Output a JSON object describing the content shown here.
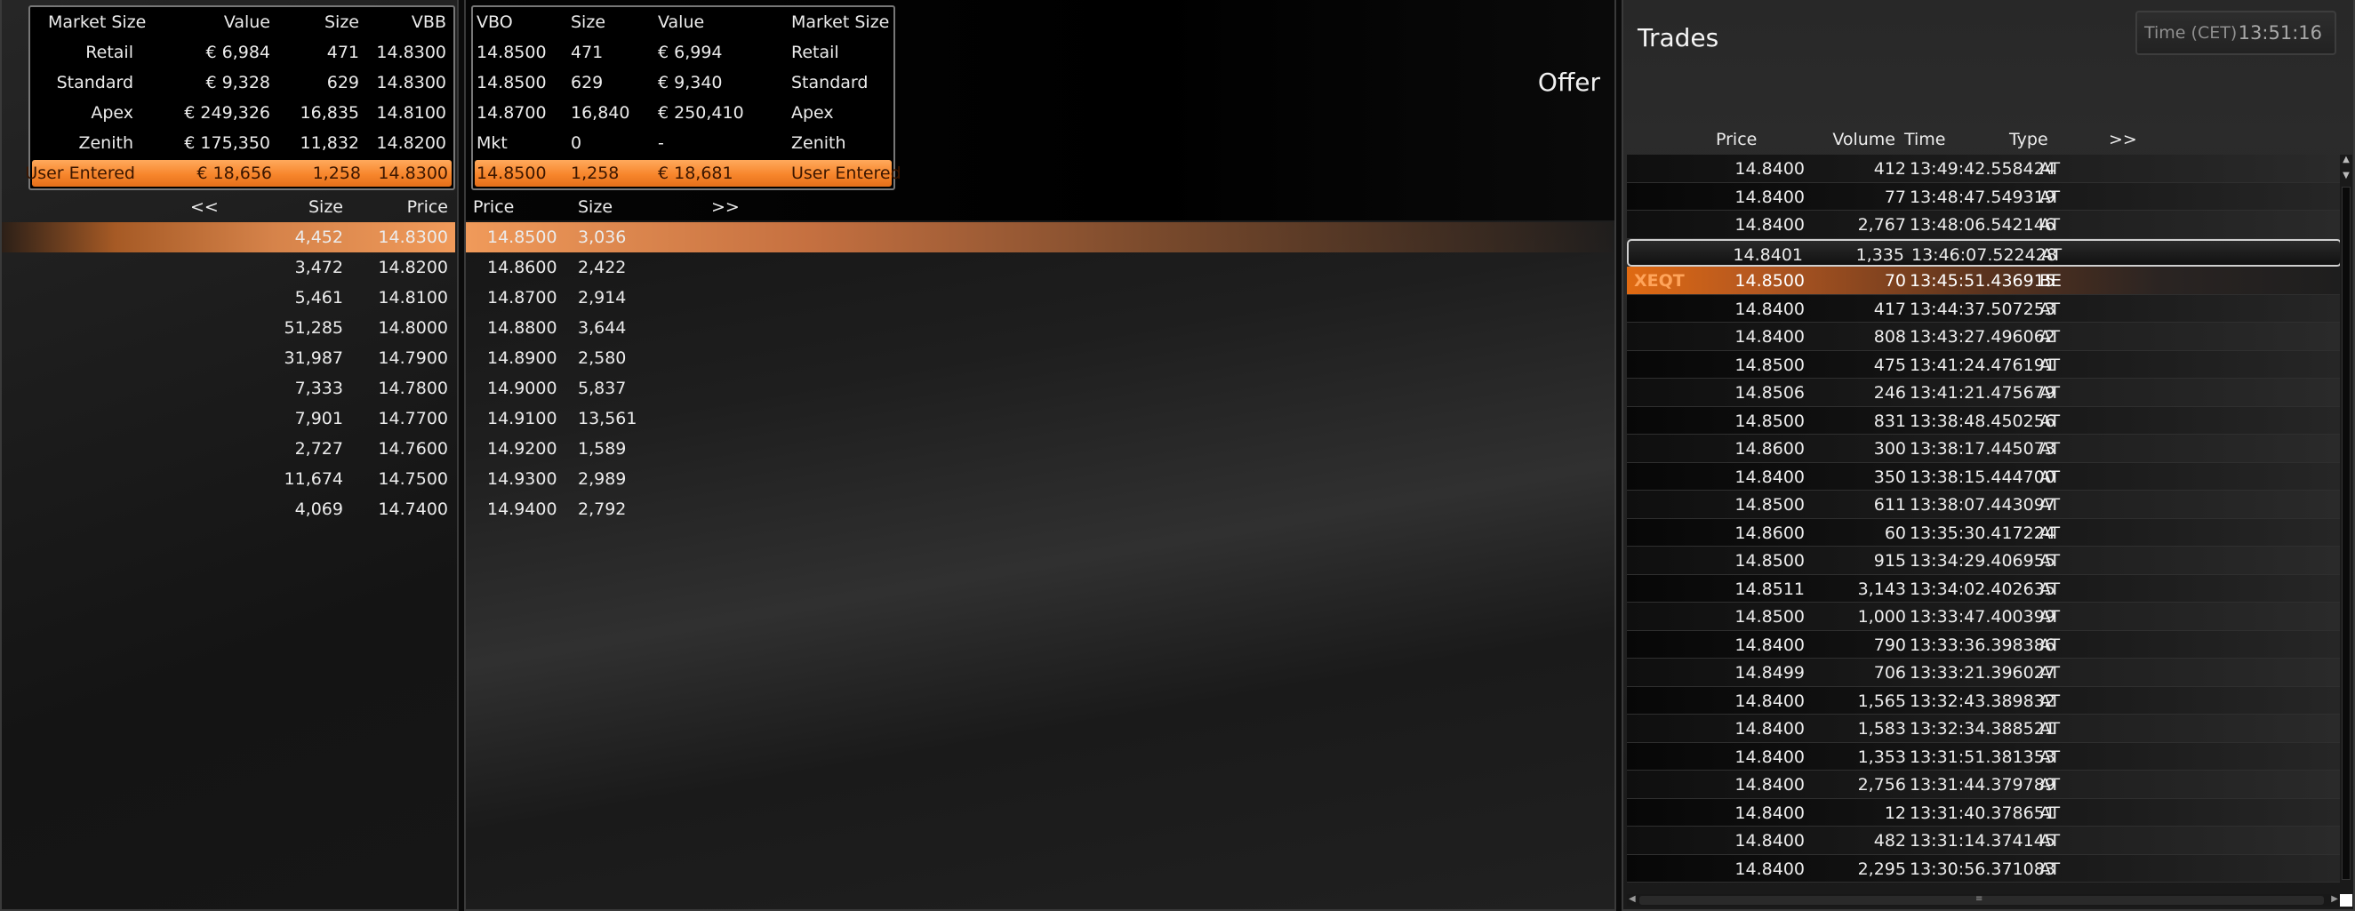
{
  "bid_summary": {
    "headers": [
      "Market Size",
      "Value",
      "Size",
      "VBB"
    ],
    "rows": [
      {
        "market": "Retail",
        "value": "€ 6,984",
        "size": "471",
        "vb": "14.8300"
      },
      {
        "market": "Standard",
        "value": "€ 9,328",
        "size": "629",
        "vb": "14.8300"
      },
      {
        "market": "Apex",
        "value": "€ 249,326",
        "size": "16,835",
        "vb": "14.8100"
      },
      {
        "market": "Zenith",
        "value": "€ 175,350",
        "size": "11,832",
        "vb": "14.8200"
      }
    ],
    "user": {
      "market": "User Entered",
      "value": "€ 18,656",
      "size": "1,258",
      "vb": "14.8300"
    }
  },
  "offer_summary": {
    "headers": [
      "VBO",
      "Size",
      "Value",
      "Market Size"
    ],
    "rows": [
      {
        "vb": "14.8500",
        "size": "471",
        "value": "€ 6,994",
        "market": "Retail"
      },
      {
        "vb": "14.8500",
        "size": "629",
        "value": "€ 9,340",
        "market": "Standard"
      },
      {
        "vb": "14.8700",
        "size": "16,840",
        "value": "€ 250,410",
        "market": "Apex"
      },
      {
        "vb": "Mkt",
        "size": "0",
        "value": "-",
        "market": "Zenith"
      }
    ],
    "user": {
      "vb": "14.8500",
      "size": "1,258",
      "value": "€ 18,681",
      "market": "User Entered"
    }
  },
  "bid_ladder": {
    "nav": "<<",
    "size_header": "Size",
    "price_header": "Price",
    "rows": [
      {
        "size": "4,452",
        "price": "14.8300"
      },
      {
        "size": "3,472",
        "price": "14.8200"
      },
      {
        "size": "5,461",
        "price": "14.8100"
      },
      {
        "size": "51,285",
        "price": "14.8000"
      },
      {
        "size": "31,987",
        "price": "14.7900"
      },
      {
        "size": "7,333",
        "price": "14.7800"
      },
      {
        "size": "7,901",
        "price": "14.7700"
      },
      {
        "size": "2,727",
        "price": "14.7600"
      },
      {
        "size": "11,674",
        "price": "14.7500"
      },
      {
        "size": "4,069",
        "price": "14.7400"
      }
    ]
  },
  "offer_ladder": {
    "title": "Offer",
    "nav": ">>",
    "price_header": "Price",
    "size_header": "Size",
    "rows": [
      {
        "price": "14.8500",
        "size": "3,036"
      },
      {
        "price": "14.8600",
        "size": "2,422"
      },
      {
        "price": "14.8700",
        "size": "2,914"
      },
      {
        "price": "14.8800",
        "size": "3,644"
      },
      {
        "price": "14.8900",
        "size": "2,580"
      },
      {
        "price": "14.9000",
        "size": "5,837"
      },
      {
        "price": "14.9100",
        "size": "13,561"
      },
      {
        "price": "14.9200",
        "size": "1,589"
      },
      {
        "price": "14.9300",
        "size": "2,989"
      },
      {
        "price": "14.9400",
        "size": "2,792"
      }
    ]
  },
  "trades": {
    "title": "Trades",
    "time_label": "Time (CET)",
    "time_value": "13:51:16",
    "headers": {
      "price": "Price",
      "volume": "Volume",
      "time": "Time",
      "type": "Type",
      "nav": ">>"
    },
    "rows": [
      {
        "flag": "",
        "price": "14.8400",
        "volume": "412",
        "time": "13:49:42.558424",
        "type": "AT"
      },
      {
        "flag": "",
        "price": "14.8400",
        "volume": "77",
        "time": "13:48:47.549319",
        "type": "AT"
      },
      {
        "flag": "",
        "price": "14.8400",
        "volume": "2,767",
        "time": "13:48:06.542146",
        "type": "AT"
      },
      {
        "flag": "",
        "price": "14.8401",
        "volume": "1,335",
        "time": "13:46:07.522428",
        "type": "AT"
      },
      {
        "flag": "XEQT",
        "price": "14.8500",
        "volume": "70",
        "time": "13:45:51.436915",
        "type": "BE"
      },
      {
        "flag": "",
        "price": "14.8400",
        "volume": "417",
        "time": "13:44:37.507253",
        "type": "AT"
      },
      {
        "flag": "",
        "price": "14.8400",
        "volume": "808",
        "time": "13:43:27.496062",
        "type": "AT"
      },
      {
        "flag": "",
        "price": "14.8500",
        "volume": "475",
        "time": "13:41:24.476191",
        "type": "AT"
      },
      {
        "flag": "",
        "price": "14.8506",
        "volume": "246",
        "time": "13:41:21.475679",
        "type": "AT"
      },
      {
        "flag": "",
        "price": "14.8500",
        "volume": "831",
        "time": "13:38:48.450256",
        "type": "AT"
      },
      {
        "flag": "",
        "price": "14.8600",
        "volume": "300",
        "time": "13:38:17.445073",
        "type": "AT"
      },
      {
        "flag": "",
        "price": "14.8400",
        "volume": "350",
        "time": "13:38:15.444700",
        "type": "AT"
      },
      {
        "flag": "",
        "price": "14.8500",
        "volume": "611",
        "time": "13:38:07.443097",
        "type": "AT"
      },
      {
        "flag": "",
        "price": "14.8600",
        "volume": "60",
        "time": "13:35:30.417224",
        "type": "AT"
      },
      {
        "flag": "",
        "price": "14.8500",
        "volume": "915",
        "time": "13:34:29.406955",
        "type": "AT"
      },
      {
        "flag": "",
        "price": "14.8511",
        "volume": "3,143",
        "time": "13:34:02.402635",
        "type": "AT"
      },
      {
        "flag": "",
        "price": "14.8500",
        "volume": "1,000",
        "time": "13:33:47.400399",
        "type": "AT"
      },
      {
        "flag": "",
        "price": "14.8400",
        "volume": "790",
        "time": "13:33:36.398386",
        "type": "AT"
      },
      {
        "flag": "",
        "price": "14.8499",
        "volume": "706",
        "time": "13:33:21.396027",
        "type": "AT"
      },
      {
        "flag": "",
        "price": "14.8400",
        "volume": "1,565",
        "time": "13:32:43.389832",
        "type": "AT"
      },
      {
        "flag": "",
        "price": "14.8400",
        "volume": "1,583",
        "time": "13:32:34.388521",
        "type": "AT"
      },
      {
        "flag": "",
        "price": "14.8400",
        "volume": "1,353",
        "time": "13:31:51.381353",
        "type": "AT"
      },
      {
        "flag": "",
        "price": "14.8400",
        "volume": "2,756",
        "time": "13:31:44.379789",
        "type": "AT"
      },
      {
        "flag": "",
        "price": "14.8400",
        "volume": "12",
        "time": "13:31:40.378651",
        "type": "AT"
      },
      {
        "flag": "",
        "price": "14.8400",
        "volume": "482",
        "time": "13:31:14.374145",
        "type": "AT"
      },
      {
        "flag": "",
        "price": "14.8400",
        "volume": "2,295",
        "time": "13:30:56.371083",
        "type": "AT"
      }
    ]
  },
  "icons": {
    "scroll_up": "▲",
    "scroll_down": "▼",
    "scroll_left": "◀",
    "scroll_right": "▶",
    "grip": "≡"
  }
}
